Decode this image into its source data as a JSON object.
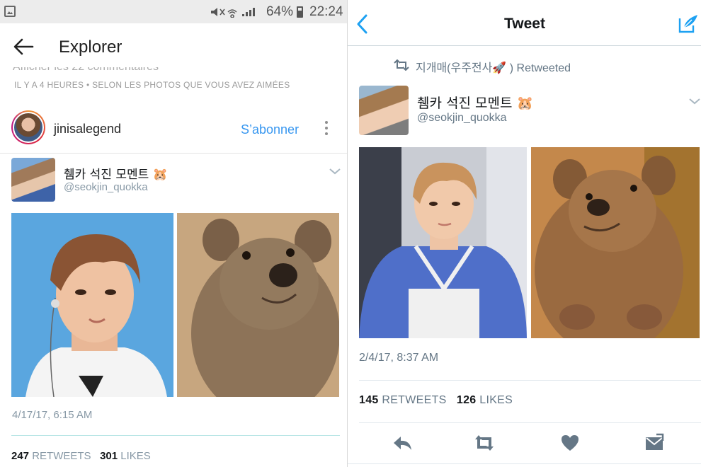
{
  "left": {
    "statusbar": {
      "icons_text": "⦿ ❂ ◢",
      "battery": "64%",
      "time": "22:24"
    },
    "appbar": {
      "back_icon": "arrow-left-icon",
      "title": "Explorer"
    },
    "cut_text": "Afficher les 22 commentaires",
    "meta": "IL Y A 4 HEURES • SELON LES PHOTOS QUE VOUS AVEZ AIMÉES",
    "post": {
      "username": "jinisalegend",
      "follow_label": "S’abonner",
      "more_icon": "more-vertical-icon"
    },
    "tweet": {
      "name": "췜카 석진 모멘트 🐹",
      "handle": "@seokjin_quokka",
      "date": "4/17/17, 6:15 AM",
      "retweets": "247",
      "retweets_label": "RETWEETS",
      "likes": "301",
      "likes_label": "LIKES"
    }
  },
  "right": {
    "nav": {
      "title": "Tweet",
      "back_icon": "chevron-left-icon",
      "compose_icon": "compose-icon",
      "accent": "#1da1f2"
    },
    "retweeted_by": "지개매(우주전사🚀 ) Retweeted",
    "tweet": {
      "name": "췜카 석진 모멘트 🐹",
      "handle": "@seokjin_quokka",
      "date": "2/4/17, 8:37 AM",
      "retweets": "145",
      "retweets_label": "RETWEETS",
      "likes": "126",
      "likes_label": "LIKES"
    },
    "actions": [
      "reply-icon",
      "retweet-icon",
      "heart-icon",
      "direct-message-icon"
    ],
    "action_color": "#657786"
  }
}
